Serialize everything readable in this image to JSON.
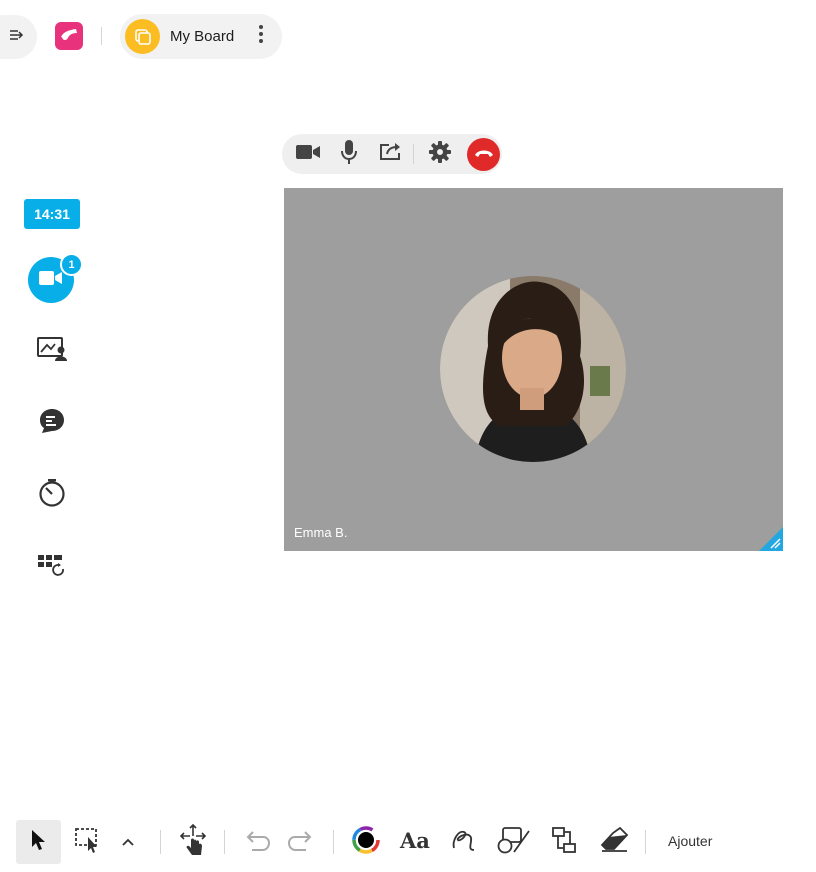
{
  "header": {
    "board_title": "My Board"
  },
  "sidebar": {
    "clock": "14:31",
    "video_count": "1",
    "items": [
      {
        "icon": "video-camera-icon"
      },
      {
        "icon": "presenter-screen-icon"
      },
      {
        "icon": "chat-bubble-icon"
      },
      {
        "icon": "timer-icon"
      },
      {
        "icon": "templates-refresh-icon"
      }
    ]
  },
  "call_toolbar": {
    "buttons": [
      "camera-icon",
      "microphone-icon",
      "share-screen-icon",
      "settings-icon",
      "hang-up-icon"
    ]
  },
  "video": {
    "participant_name": "Emma B."
  },
  "bottom_toolbar": {
    "tools": [
      "select-arrow-icon",
      "area-select-icon",
      "chevron-up-icon",
      "pan-hand-icon",
      "undo-icon",
      "redo-icon",
      "color-picker-icon",
      "text-icon",
      "pen-icon",
      "shapes-icon",
      "connector-icon",
      "eraser-icon"
    ],
    "add_label": "Ajouter"
  },
  "colors": {
    "accent": "#08aee8",
    "logo": "#e8327c",
    "board_icon": "#fbbd22",
    "hangup": "#e02a2a",
    "video_bg": "#9e9e9e"
  }
}
